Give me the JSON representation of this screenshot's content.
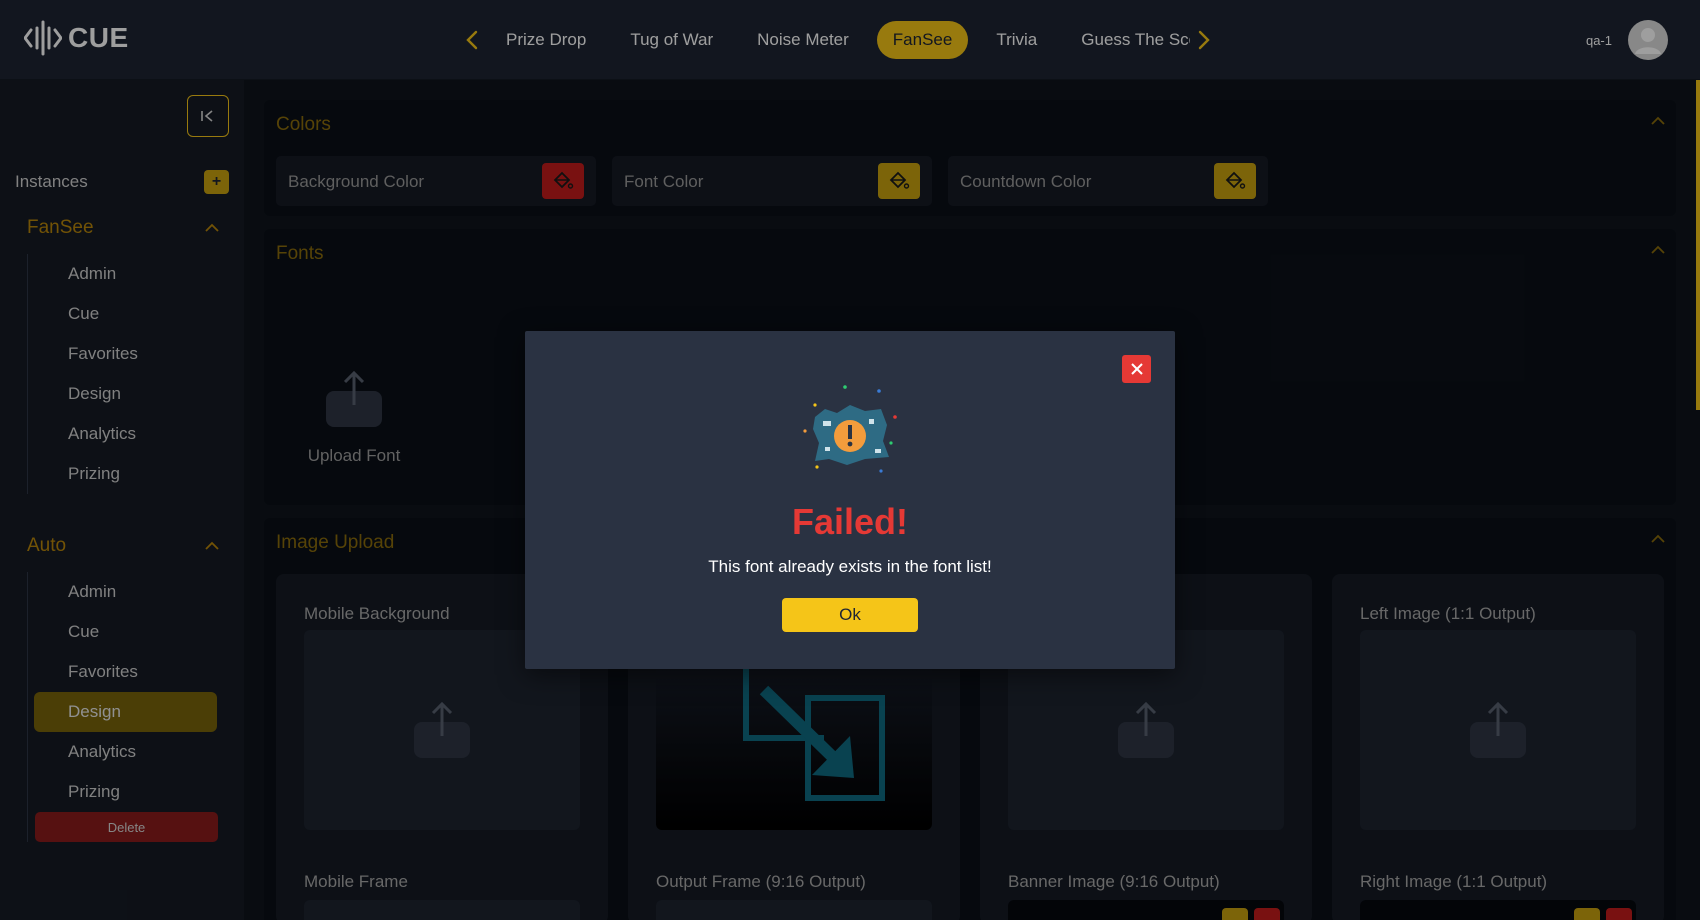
{
  "app": {
    "logo_text": "CUE"
  },
  "topnav": {
    "tabs": [
      {
        "label": "Prize Drop"
      },
      {
        "label": "Tug of War"
      },
      {
        "label": "Noise Meter"
      },
      {
        "label": "FanSee"
      },
      {
        "label": "Trivia"
      },
      {
        "label": "Guess The Sco"
      }
    ],
    "active_tab": "FanSee",
    "user_name": "qa-1"
  },
  "sidebar": {
    "instances_label": "Instances",
    "add_icon": "+",
    "groups": [
      {
        "title": "FanSee",
        "items": [
          {
            "label": "Admin"
          },
          {
            "label": "Cue"
          },
          {
            "label": "Favorites"
          },
          {
            "label": "Design"
          },
          {
            "label": "Analytics"
          },
          {
            "label": "Prizing"
          }
        ]
      },
      {
        "title": "Auto",
        "items": [
          {
            "label": "Admin"
          },
          {
            "label": "Cue"
          },
          {
            "label": "Favorites"
          },
          {
            "label": "Design"
          },
          {
            "label": "Analytics"
          },
          {
            "label": "Prizing"
          }
        ],
        "active_item": "Design"
      }
    ],
    "delete_label": "Delete"
  },
  "main": {
    "colors": {
      "title": "Colors",
      "fields": [
        {
          "label": "Background Color",
          "swatch": "#c41c1c"
        },
        {
          "label": "Font Color",
          "swatch": "#c9a20f"
        },
        {
          "label": "Countdown Color",
          "swatch": "#c9a20f"
        }
      ]
    },
    "fonts": {
      "title": "Fonts",
      "upload_label": "Upload Font"
    },
    "image_upload": {
      "title": "Image Upload",
      "cards": [
        {
          "label": "Mobile Background",
          "bottom_label": "Mobile Frame"
        },
        {
          "label": "",
          "bottom_label": "Output Frame (9:16 Output)"
        },
        {
          "label": "",
          "bottom_label": "Banner Image (9:16 Output)"
        },
        {
          "label": "Left Image (1:1 Output)",
          "bottom_label": "Right Image (1:1 Output)"
        }
      ]
    }
  },
  "modal": {
    "title": "Failed!",
    "message": "This font already exists in the font list!",
    "ok_label": "Ok",
    "illustration": "warning-illustration"
  },
  "theme": {
    "accent": "#f5c518",
    "danger": "#e53935",
    "bg": "#0f141c",
    "panel": "#1e2533"
  }
}
